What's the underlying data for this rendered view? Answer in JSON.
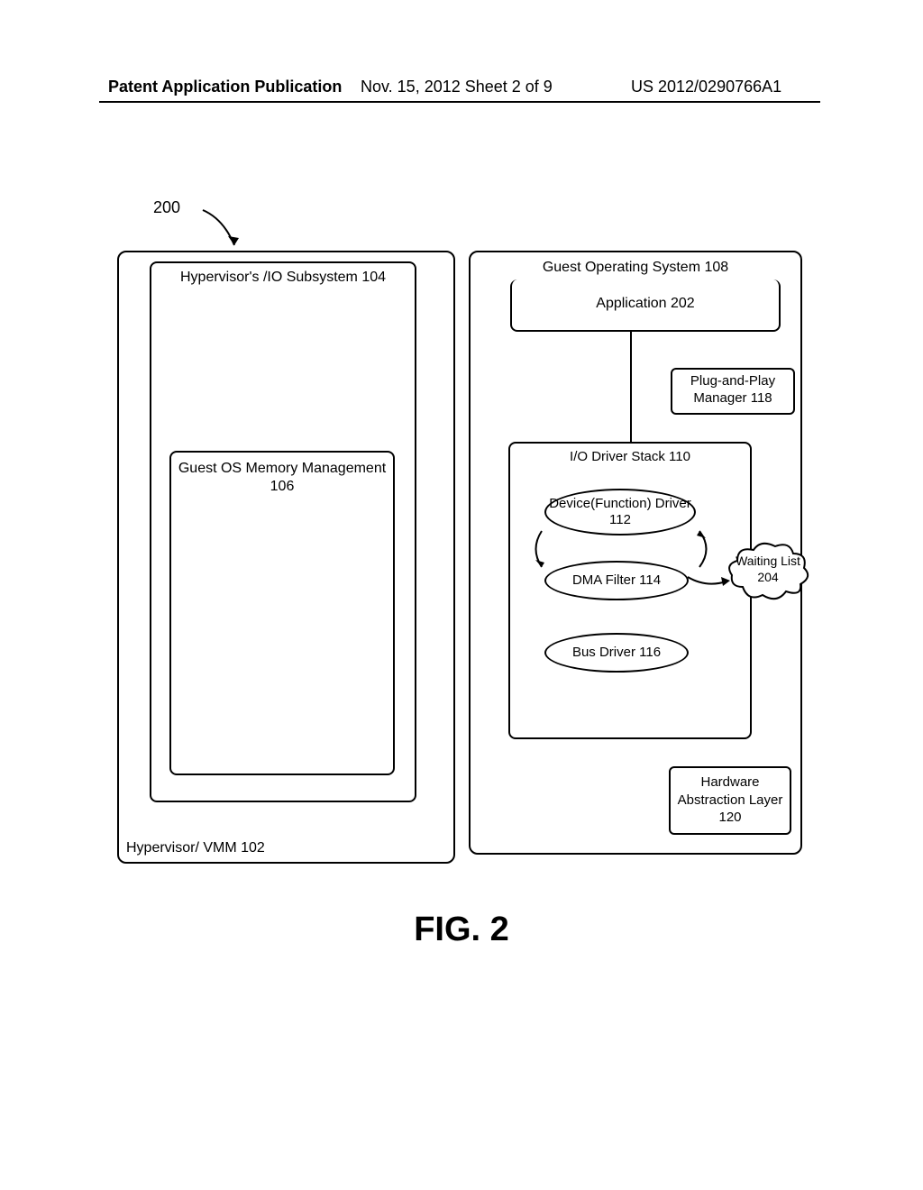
{
  "header": {
    "left": "Patent Application Publication",
    "mid": "Nov. 15, 2012  Sheet 2 of 9",
    "right": "US 2012/0290766A1"
  },
  "references": {
    "ref200": "200"
  },
  "hypervisor": {
    "label": "Hypervisor/ VMM 102",
    "io_subsystem": "Hypervisor's /IO Subsystem 104",
    "guest_mem": "Guest OS Memory Management 106"
  },
  "guest_os": {
    "label": "Guest Operating System 108",
    "application": "Application 202",
    "pnp": "Plug-and-Play Manager 118",
    "io_stack": "I/O Driver Stack 110",
    "device_driver": "Device(Function) Driver 112",
    "dma_filter": "DMA Filter 114",
    "bus_driver": "Bus Driver 116",
    "waiting_list": "Waiting List 204",
    "hal": "Hardware Abstraction Layer 120"
  },
  "caption": "FIG. 2"
}
